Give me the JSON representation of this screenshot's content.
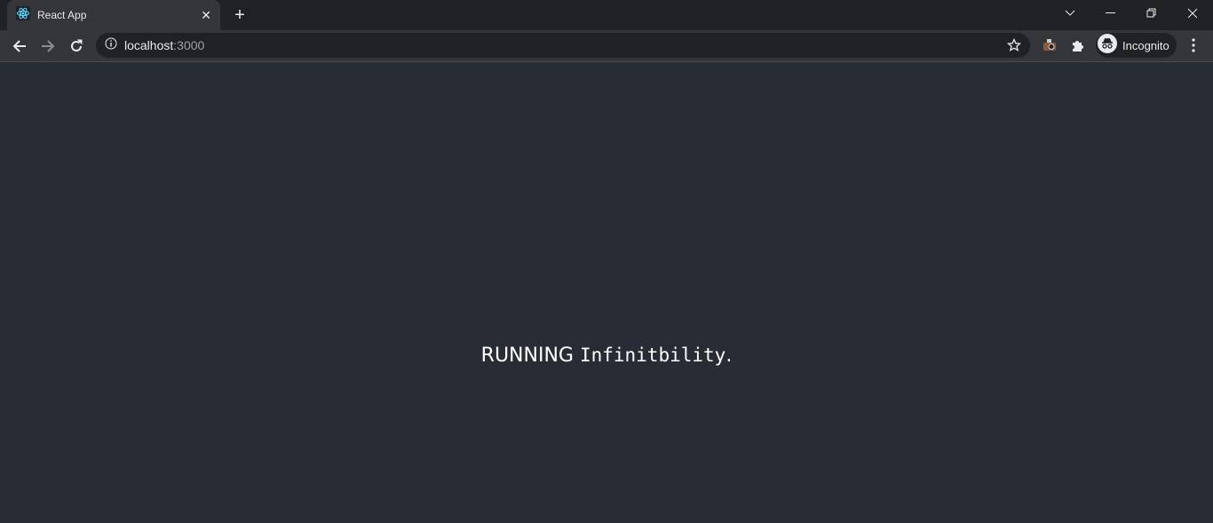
{
  "browser": {
    "tab": {
      "title": "React App",
      "favicon": "react-icon"
    },
    "address": {
      "host": "localhost",
      "port": ":3000"
    },
    "profile_label": "Incognito"
  },
  "page": {
    "prefix": "RUNNING ",
    "code": "Infinitbility",
    "suffix": "."
  }
}
